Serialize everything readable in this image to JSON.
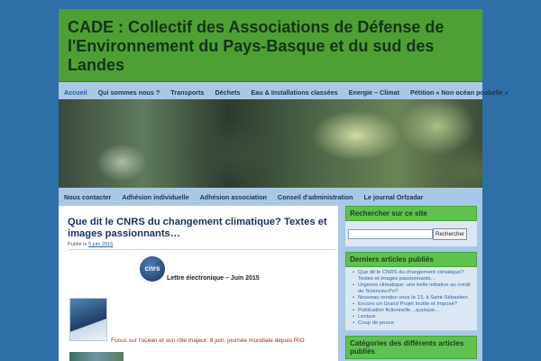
{
  "site": {
    "title": "CADE : Collectif des Associations de Défense de l'Environnement du Pays-Basque et du sud des Landes"
  },
  "nav_main": [
    {
      "label": "Accueil",
      "current": true
    },
    {
      "label": "Qui sommes nous ?"
    },
    {
      "label": "Transports"
    },
    {
      "label": "Déchets"
    },
    {
      "label": "Eau & Installations classées"
    },
    {
      "label": "Energie – Climat"
    },
    {
      "label": "Pétition « Non océan poubelle »"
    }
  ],
  "nav_sub": [
    {
      "label": "Nous contacter"
    },
    {
      "label": "Adhésion individuelle"
    },
    {
      "label": "Adhésion association"
    },
    {
      "label": "Conseil d'administration"
    },
    {
      "label": "Le journal Orfzadar"
    }
  ],
  "post": {
    "title": "Que dit le CNRS du changement climatique? Textes et images passionnants…",
    "meta_prefix": "Publié le",
    "date": "5 juin 2015",
    "logo_text": "cnrs",
    "letter_title": "Lettre électronique – Juin 2015",
    "focus_line": "Focus sur l'océan et son rôle majeur: 8 juin, journée mondiale depuis RIO"
  },
  "sidebar": {
    "search": {
      "title": "Rechercher sur ce site",
      "placeholder": "",
      "button": "Rechercher"
    },
    "recent": {
      "title": "Derniers articles publiés",
      "items": [
        "Que dit le CNRS du changement climatique? Textes et images passionnants…",
        "Urgence climatique: une belle initiative au crédit de Sciences-Po?",
        "Nouveau rendez-vous le 13, à Saint-Sébastien",
        "Encore un Grand Projet Inutile et Imposé?",
        "Publication fictionnelle…quoique…",
        "Lecture",
        "Coup de pouce"
      ]
    },
    "categories": {
      "title": "Catégories des différents articles publiés"
    }
  },
  "colors": {
    "background": "#2f6fa8",
    "header": "#4ea035",
    "widget_title": "#5fc24e"
  }
}
